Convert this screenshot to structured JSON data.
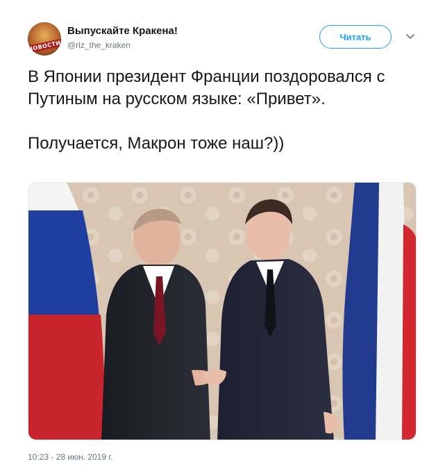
{
  "account": {
    "name": "Выпускайте Кракена!",
    "handle": "@rlz_the_kraken",
    "avatar_badge": "НОВОСТИ"
  },
  "follow_button": {
    "label": "Читать"
  },
  "menu": {
    "icon": "chevron-down-icon"
  },
  "tweet": {
    "paragraph1": "В Японии президент Франции поздоровался с Путиным на русском языке: «Привет».",
    "paragraph2": "Получается, Макрон тоже наш?))"
  },
  "photo": {
    "icons": [
      "russia-flag",
      "france-flag"
    ]
  },
  "timestamp": "10:23 - 28 июн. 2019 г.",
  "colors": {
    "accent": "#1da1f2",
    "text": "#14171a",
    "muted": "#657786"
  }
}
